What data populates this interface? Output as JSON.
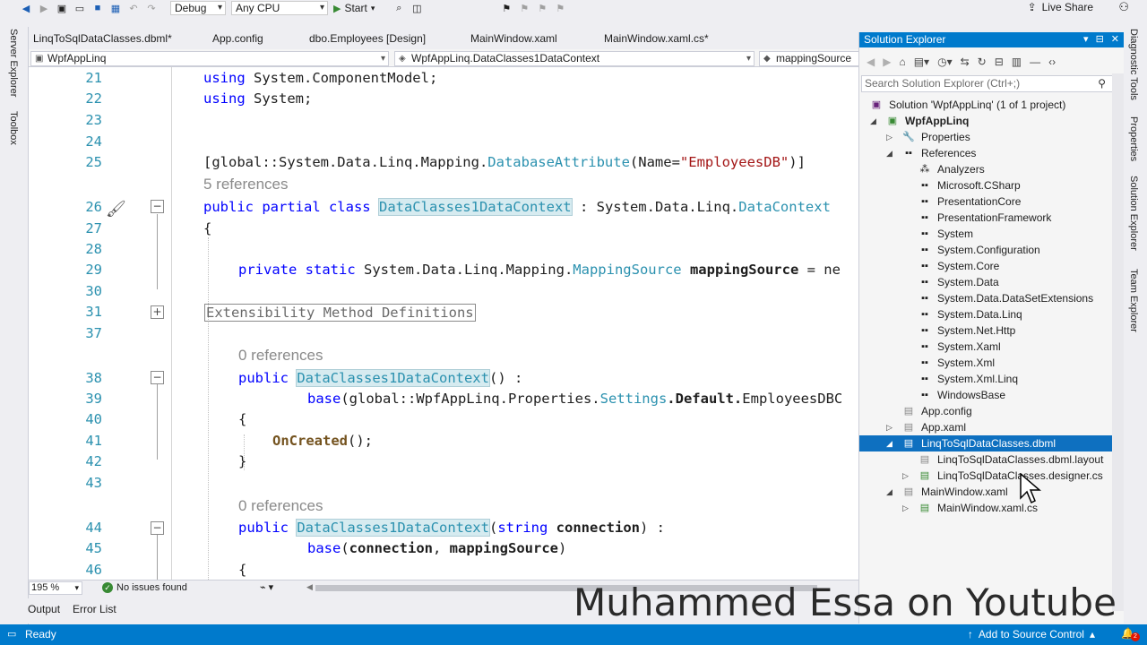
{
  "toolbar": {
    "config": "Debug",
    "platform": "Any CPU",
    "start_label": "Start",
    "live_share": "Live Share"
  },
  "left_rail": {
    "server_explorer": "Server Explorer",
    "toolbox": "Toolbox"
  },
  "tabs": [
    "LinqToSqlDataClasses.dbml*",
    "App.config",
    "dbo.Employees [Design]",
    "MainWindow.xaml",
    "MainWindow.xaml.cs*"
  ],
  "nav": {
    "project": "WpfAppLinq",
    "type": "WpfAppLinq.DataClasses1DataContext",
    "member": "mappingSource"
  },
  "editor": {
    "lines": [
      "21",
      "22",
      "23",
      "24",
      "25",
      "26",
      "27",
      "28",
      "29",
      "30",
      "31",
      "37",
      "38",
      "39",
      "40",
      "41",
      "42",
      "43",
      "44",
      "45",
      "46"
    ],
    "ref5": "5 references",
    "ref0a": "0 references",
    "ref0b": "0 references",
    "code": {
      "l21_kw": "using",
      "l21_rest": " System.ComponentModel;",
      "l22_kw": "using",
      "l22_rest": " System;",
      "l25_a": "[global::System.Data.Linq.Mapping.",
      "l25_b": "DatabaseAttribute",
      "l25_c": "(Name=",
      "l25_d": "\"EmployeesDB\"",
      "l25_e": ")]",
      "l26_a": "public partial class",
      "l26_b": "DataClasses1DataContext",
      "l26_c": " : System.Data.Linq.",
      "l26_d": "DataContext",
      "l27": "{",
      "l29_a": "private static",
      "l29_b": " System.Data.Linq.Mapping.",
      "l29_c": "MappingSource",
      "l29_d": " mappingSource",
      "l29_e": " = ne",
      "l31": "Extensibility Method Definitions",
      "l38_a": "public",
      "l38_b": "DataClasses1DataContext",
      "l38_c": "() :",
      "l39_a": "base",
      "l39_b": "(global::WpfAppLinq.Properties.",
      "l39_c": "Settings",
      "l39_d": ".Default.",
      "l39_e": "EmployeesDBC",
      "l40": "{",
      "l41": "OnCreated",
      "l41_b": "();",
      "l42": "}",
      "l44_a": "public",
      "l44_b": "DataClasses1DataContext",
      "l44_c": "(",
      "l44_d": "string",
      "l44_e": " connection",
      "l44_f": ") :",
      "l45_a": "base",
      "l45_b": "(",
      "l45_c": "connection",
      "l45_d": ", ",
      "l45_e": "mappingSource",
      "l45_f": ")",
      "l46": "{"
    }
  },
  "editor_status": {
    "zoom": "195 %",
    "issues": "No issues found"
  },
  "bottom_tabs": {
    "output": "Output",
    "error_list": "Error List"
  },
  "solution_explorer": {
    "title": "Solution Explorer",
    "search_placeholder": "Search Solution Explorer (Ctrl+;)",
    "items": [
      "Solution 'WpfAppLinq' (1 of 1 project)",
      "WpfAppLinq",
      "Properties",
      "References",
      "Analyzers",
      "Microsoft.CSharp",
      "PresentationCore",
      "PresentationFramework",
      "System",
      "System.Configuration",
      "System.Core",
      "System.Data",
      "System.Data.DataSetExtensions",
      "System.Data.Linq",
      "System.Net.Http",
      "System.Xaml",
      "System.Xml",
      "System.Xml.Linq",
      "WindowsBase",
      "App.config",
      "App.xaml",
      "LinqToSqlDataClasses.dbml",
      "LinqToSqlDataClasses.dbml.layout",
      "LinqToSqlDataClasses.designer.cs",
      "MainWindow.xaml",
      "MainWindow.xaml.cs"
    ]
  },
  "right_rail": {
    "diag": "Diagnostic Tools",
    "props": "Properties",
    "se": "Solution Explorer",
    "team": "Team Explorer"
  },
  "status": {
    "ready": "Ready",
    "source_control": "Add to Source Control",
    "badge": "2"
  },
  "watermark": "Muhammed Essa on Youtube",
  "colors": {
    "accent": "#007acc",
    "selection": "#0e70c0",
    "keyword": "#0000ff",
    "type": "#2b91af",
    "string": "#a31515"
  }
}
